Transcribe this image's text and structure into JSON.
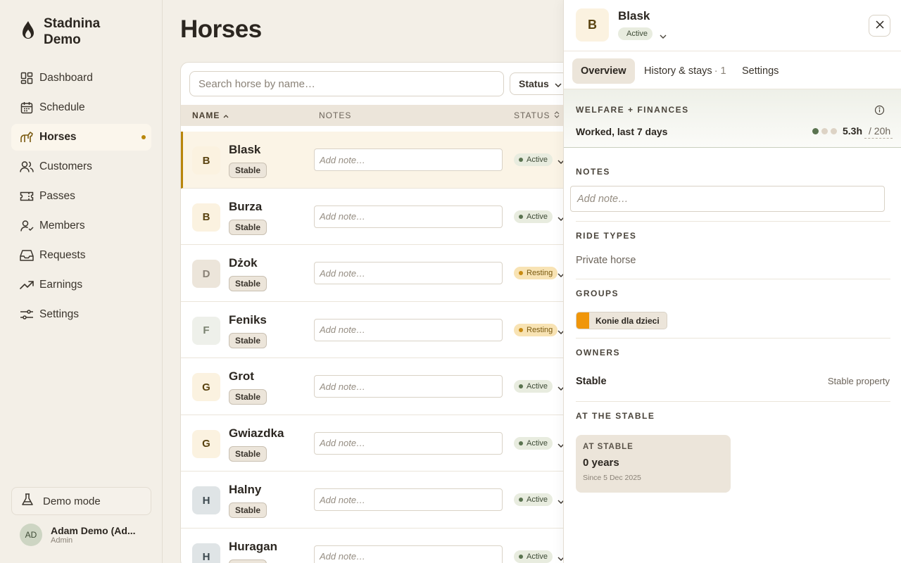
{
  "brand": {
    "name": "Stadnina Demo"
  },
  "nav": [
    {
      "label": "Dashboard",
      "icon": "dashboard-icon"
    },
    {
      "label": "Schedule",
      "icon": "calendar-icon"
    },
    {
      "label": "Horses",
      "icon": "horse-icon",
      "active": true
    },
    {
      "label": "Customers",
      "icon": "customers-icon"
    },
    {
      "label": "Passes",
      "icon": "ticket-icon"
    },
    {
      "label": "Members",
      "icon": "member-icon"
    },
    {
      "label": "Requests",
      "icon": "inbox-icon"
    },
    {
      "label": "Earnings",
      "icon": "trend-icon"
    },
    {
      "label": "Settings",
      "icon": "sliders-icon"
    }
  ],
  "demo_mode": "Demo mode",
  "user": {
    "initials": "AD",
    "name": "Adam Demo (Ad...",
    "role": "Admin"
  },
  "page": {
    "title": "Horses"
  },
  "search": {
    "placeholder": "Search horse by name…"
  },
  "filter": {
    "status_label": "Status"
  },
  "table": {
    "headers": {
      "name": "NAME",
      "notes": "NOTES",
      "status": "STATUS"
    },
    "note_placeholder": "Add note…",
    "rows": [
      {
        "initial": "B",
        "name": "Blask",
        "tag": "Stable",
        "status": "Active",
        "avatar_bg": "#fbf2e0",
        "avatar_fg": "#5a4310"
      },
      {
        "initial": "B",
        "name": "Burza",
        "tag": "Stable",
        "status": "Active",
        "avatar_bg": "#fbf2e0",
        "avatar_fg": "#5a4310"
      },
      {
        "initial": "D",
        "name": "Dżok",
        "tag": "Stable",
        "status": "Resting",
        "avatar_bg": "#ece5da",
        "avatar_fg": "#8a8277"
      },
      {
        "initial": "F",
        "name": "Feniks",
        "tag": "Stable",
        "status": "Resting",
        "avatar_bg": "#eef0ea",
        "avatar_fg": "#7a8270"
      },
      {
        "initial": "G",
        "name": "Grot",
        "tag": "Stable",
        "status": "Active",
        "avatar_bg": "#fbf2e0",
        "avatar_fg": "#5a4310"
      },
      {
        "initial": "G",
        "name": "Gwiazdka",
        "tag": "Stable",
        "status": "Active",
        "avatar_bg": "#fbf2e0",
        "avatar_fg": "#5a4310"
      },
      {
        "initial": "H",
        "name": "Halny",
        "tag": "Stable",
        "status": "Active",
        "avatar_bg": "#dfe4e6",
        "avatar_fg": "#3e4a50"
      },
      {
        "initial": "H",
        "name": "Huragan",
        "tag": "Stable",
        "status": "Active",
        "avatar_bg": "#dfe4e6",
        "avatar_fg": "#3e4a50"
      }
    ]
  },
  "panel": {
    "initial": "B",
    "name": "Blask",
    "status": "Active",
    "tabs": {
      "overview": "Overview",
      "history": "History & stays",
      "history_count": "· 1",
      "settings": "Settings"
    },
    "welfare": {
      "title": "WELFARE + FINANCES",
      "worked_label": "Worked, last 7 days",
      "worked_value": "5.3h",
      "worked_max": "/ 20h"
    },
    "notes": {
      "title": "NOTES",
      "placeholder": "Add note…"
    },
    "ride_types": {
      "title": "RIDE TYPES",
      "value": "Private horse"
    },
    "groups": {
      "title": "GROUPS",
      "items": [
        {
          "label": "Konie dla dzieci",
          "color": "#f0960a"
        }
      ]
    },
    "owners": {
      "title": "OWNERS",
      "name": "Stable",
      "type": "Stable property"
    },
    "at_stable": {
      "title": "AT THE STABLE",
      "card_label": "AT STABLE",
      "duration": "0 years",
      "since": "Since 5 Dec 2025"
    }
  },
  "colors": {
    "accent": "#b8860b",
    "active": "#5a7350",
    "resting": "#c88a10"
  }
}
